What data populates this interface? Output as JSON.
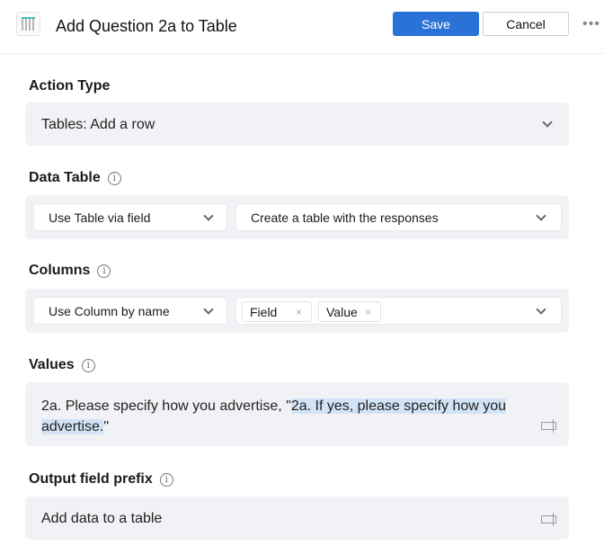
{
  "header": {
    "title": "Add Question 2a to Table",
    "save_label": "Save",
    "cancel_label": "Cancel",
    "more_label": "•••"
  },
  "action_type": {
    "label": "Action Type",
    "value": "Tables: Add a row"
  },
  "data_table": {
    "label": "Data Table",
    "info": "i",
    "mode": "Use Table via field",
    "value": "Create a table with the responses"
  },
  "columns": {
    "label": "Columns",
    "info": "i",
    "mode": "Use Column by name",
    "tags": [
      "Field",
      "Value"
    ],
    "remove": "×"
  },
  "values": {
    "label": "Values",
    "info": "i",
    "text_plain": "2a. Please specify how you advertise, \"",
    "text_highlighted": "2a. If yes, please specify how you advertise.",
    "text_end": "\""
  },
  "output_prefix": {
    "label": "Output field prefix",
    "info": "i",
    "value": "Add data to a table"
  }
}
